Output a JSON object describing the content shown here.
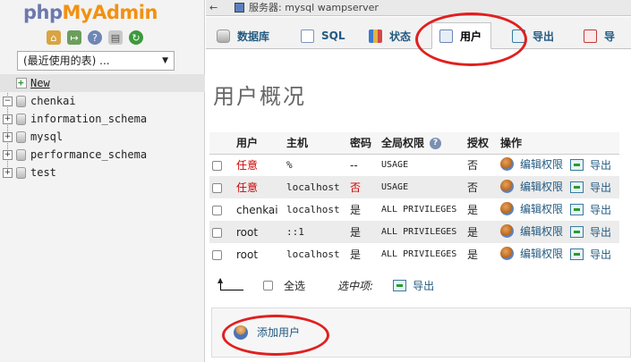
{
  "logo": {
    "php": "php",
    "my": "My",
    "admin": "Admin"
  },
  "sidebar": {
    "tool_icons": [
      "home-icon",
      "logout-icon",
      "help-icon",
      "docs-icon",
      "reload-icon"
    ],
    "recent_select": "(最近使用的表) ...",
    "tree": [
      {
        "label": "New",
        "type": "new"
      },
      {
        "label": "chenkai",
        "type": "db"
      },
      {
        "label": "information_schema",
        "type": "db"
      },
      {
        "label": "mysql",
        "type": "db"
      },
      {
        "label": "performance_schema",
        "type": "db"
      },
      {
        "label": "test",
        "type": "db"
      }
    ]
  },
  "topbar": {
    "back": "←",
    "server": "服务器: mysql wampserver"
  },
  "tabs": [
    {
      "label": "数据库",
      "icon": "database-icon"
    },
    {
      "label": "SQL",
      "icon": "sql-icon"
    },
    {
      "label": "状态",
      "icon": "status-icon"
    },
    {
      "label": "用户",
      "icon": "users-icon",
      "active": true
    },
    {
      "label": "导出",
      "icon": "export-icon"
    },
    {
      "label": "导",
      "icon": "import-icon"
    }
  ],
  "page_title": "用户概况",
  "table": {
    "headers": [
      "",
      "用户",
      "主机",
      "密码",
      "全局权限",
      "授权",
      "操作"
    ],
    "rows": [
      {
        "user": "任意",
        "host": "%",
        "password": "--",
        "privileges": "USAGE",
        "grant": "否",
        "edit": "编辑权限",
        "export": "导出",
        "user_red": true,
        "pass_red": false
      },
      {
        "user": "任意",
        "host": "localhost",
        "password": "否",
        "privileges": "USAGE",
        "grant": "否",
        "edit": "编辑权限",
        "export": "导出",
        "user_red": true,
        "pass_red": true
      },
      {
        "user": "chenkai",
        "host": "localhost",
        "password": "是",
        "privileges": "ALL PRIVILEGES",
        "grant": "是",
        "edit": "编辑权限",
        "export": "导出",
        "user_red": false,
        "pass_red": false
      },
      {
        "user": "root",
        "host": "::1",
        "password": "是",
        "privileges": "ALL PRIVILEGES",
        "grant": "是",
        "edit": "编辑权限",
        "export": "导出",
        "user_red": false,
        "pass_red": false
      },
      {
        "user": "root",
        "host": "localhost",
        "password": "是",
        "privileges": "ALL PRIVILEGES",
        "grant": "是",
        "edit": "编辑权限",
        "export": "导出",
        "user_red": false,
        "pass_red": false
      }
    ]
  },
  "bulk": {
    "select_all": "全选",
    "with_selected": "选中项:",
    "export": "导出"
  },
  "add_user": "添加用户",
  "colors": {
    "link": "#235a81",
    "red_text": "#cc0000",
    "annotation": "#e02020",
    "logo_php": "#6c78af",
    "logo_myadmin": "#f29111"
  }
}
